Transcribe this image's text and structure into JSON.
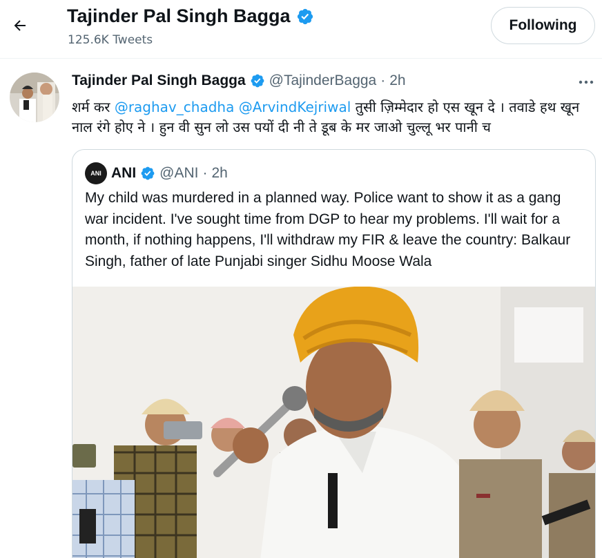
{
  "header": {
    "title": "Tajinder Pal Singh Bagga",
    "tweet_count": "125.6K Tweets",
    "follow_label": "Following"
  },
  "tweet": {
    "name": "Tajinder Pal Singh Bagga",
    "handle": "@TajinderBagga",
    "separator": "·",
    "time": "2h",
    "text_before": "शर्म कर ",
    "mention1": "@raghav_chadha",
    "mention2": "@ArvindKejriwal",
    "text_after": " तुसी ज़िम्मेदार हो एस खून दे । तवाडे हथ खून नाल रंगे होए ने । हुन वी सुन लो उस पयों दी नी ते डूब के मर जाओ चुल्लू भर पानी च"
  },
  "quote": {
    "logo_text": "ANI",
    "name": "ANI",
    "handle": "@ANI",
    "separator": "·",
    "time": "2h",
    "text": "My child was murdered in a planned way. Police want to show it as a gang war incident. I've sought time from DGP to hear my problems. I'll wait for a month, if nothing happens, I'll withdraw my FIR & leave the country: Balkaur Singh, father of late Punjabi singer Sidhu Moose Wala"
  },
  "colors": {
    "accent": "#1d9bf0",
    "secondary_text": "#536471",
    "border": "#cfd9de",
    "turban": "#e8a21a"
  },
  "icons": {
    "back": "arrow-left-icon",
    "verified": "verified-badge-icon",
    "more": "more-dots-icon"
  }
}
